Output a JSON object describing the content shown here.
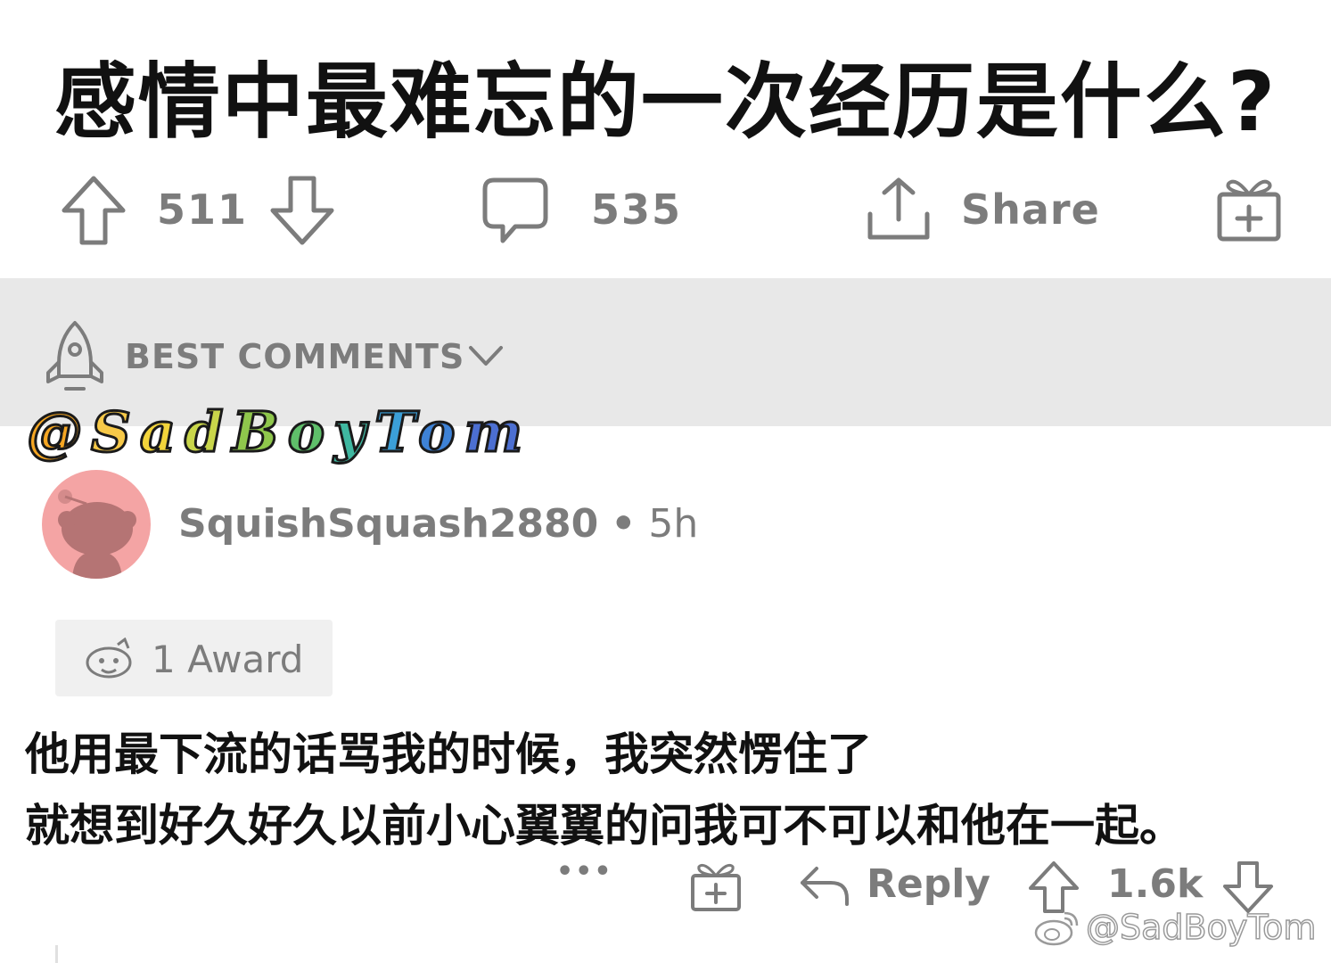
{
  "post": {
    "title": "感情中最难忘的一次经历是什么?",
    "upvotes": "511",
    "comments": "535",
    "share_label": "Share"
  },
  "sort": {
    "label": "BEST COMMENTS"
  },
  "watermark": {
    "top_chars": [
      "@",
      "S",
      "a",
      "d",
      "B",
      "o",
      "y",
      "T",
      "o",
      "m"
    ],
    "bottom": "@SadBoyTom"
  },
  "comment": {
    "username": "SquishSquash2880",
    "separator": "•",
    "time": "5h",
    "award_label": "1 Award",
    "lines": [
      "他用最下流的话骂我的时候，我突然愣住了",
      "就想到好久好久以前小心翼翼的问我可不可以和他在一起。"
    ],
    "more": "•••",
    "reply_label": "Reply",
    "score": "1.6k"
  },
  "colors": {
    "icon_gray": "#7c7c7c",
    "sort_bg": "#e8e8e8",
    "avatar_bg": "#f4a4a4"
  },
  "icons": [
    "upvote-icon",
    "downvote-icon",
    "comment-icon",
    "share-icon",
    "gift-icon",
    "rocket-icon",
    "chevron-down-icon",
    "award-icon",
    "reply-icon",
    "weibo-icon"
  ]
}
